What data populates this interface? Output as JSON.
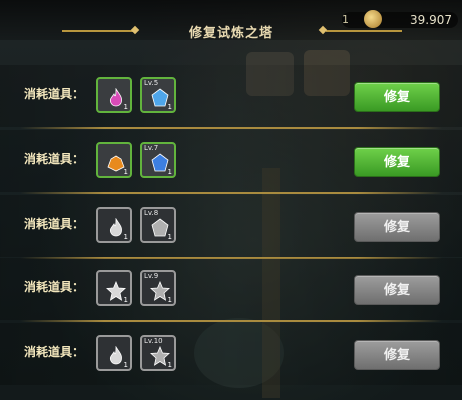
{
  "header": {
    "title": "修复试炼之塔",
    "badge": "1",
    "currency": "39.907"
  },
  "rows": [
    {
      "label": "消耗道具：",
      "button_label": "修复",
      "button_enabled": true,
      "items": [
        {
          "icon": "flame-icon",
          "level": "",
          "count": "1",
          "color": "#d94bb8"
        },
        {
          "icon": "blue-gem-icon",
          "level": "Lv.5",
          "count": "1",
          "color": "#4fa6ea"
        }
      ]
    },
    {
      "label": "消耗道具：",
      "button_label": "修复",
      "button_enabled": true,
      "items": [
        {
          "icon": "orange-ore-icon",
          "level": "",
          "count": "1",
          "color": "#e88a1e"
        },
        {
          "icon": "blue-gem-icon",
          "level": "Lv.7",
          "count": "1",
          "color": "#3d7fe0"
        }
      ]
    },
    {
      "label": "消耗道具：",
      "button_label": "修复",
      "button_enabled": false,
      "items": [
        {
          "icon": "white-flame-icon",
          "level": "",
          "count": "1",
          "color": "#d8d8d8"
        },
        {
          "icon": "grey-cube-icon",
          "level": "Lv.8",
          "count": "1",
          "color": "#b0b0b0"
        }
      ]
    },
    {
      "label": "消耗道具：",
      "button_label": "修复",
      "button_enabled": false,
      "items": [
        {
          "icon": "white-crystal-icon",
          "level": "",
          "count": "1",
          "color": "#d8d8d8"
        },
        {
          "icon": "grey-star-gem-icon",
          "level": "Lv.9",
          "count": "1",
          "color": "#b0b0b0"
        }
      ]
    },
    {
      "label": "消耗道具：",
      "button_label": "修复",
      "button_enabled": false,
      "items": [
        {
          "icon": "white-swirl-icon",
          "level": "",
          "count": "1",
          "color": "#d8d8d8"
        },
        {
          "icon": "grey-leaf-gem-icon",
          "level": "Lv.10",
          "count": "1",
          "color": "#b0b0b0"
        }
      ]
    }
  ]
}
